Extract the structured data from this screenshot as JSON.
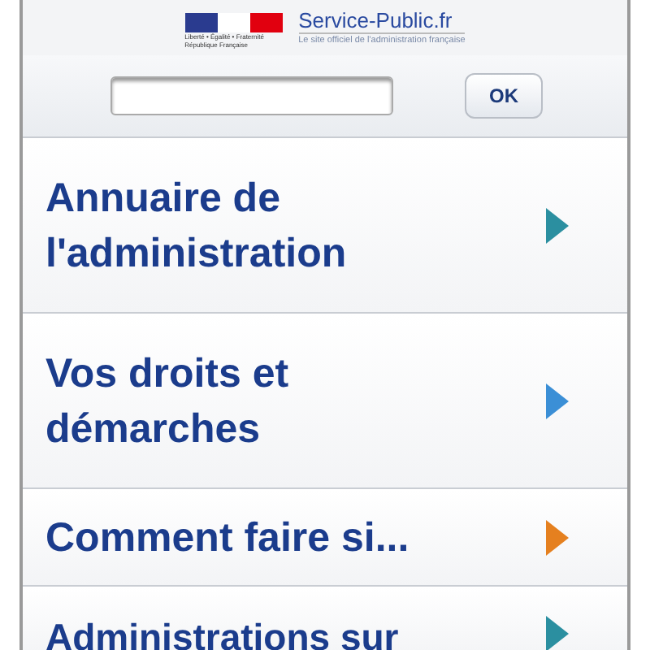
{
  "header": {
    "logo_lines": [
      "Liberté • Égalité • Fraternité",
      "République Française"
    ],
    "site_name": "Service-Public.fr",
    "tagline": "Le site officiel de l'administration française"
  },
  "search": {
    "button": "OK"
  },
  "menu": [
    {
      "label": "Annuaire de l'administration",
      "color": "#2b8fa0"
    },
    {
      "label": "Vos droits et démarches",
      "color": "#3b8fd6"
    },
    {
      "label": "Comment faire si...",
      "color": "#e5801f"
    },
    {
      "label": "Administrations sur",
      "color": "#2b8fa0"
    }
  ]
}
